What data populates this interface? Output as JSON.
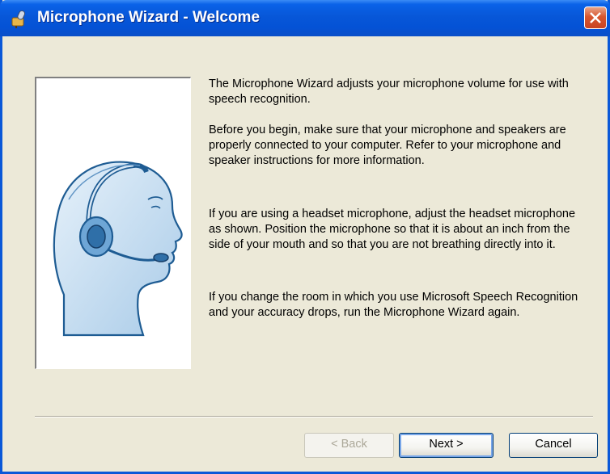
{
  "window": {
    "title": "Microphone Wizard - Welcome"
  },
  "content": {
    "paragraphs": [
      "The Microphone Wizard adjusts your microphone volume for use with speech recognition.",
      "Before you begin, make sure that your microphone and speakers are properly connected to your computer. Refer to your microphone and speaker instructions for more information.",
      "If you are using a headset microphone, adjust the headset microphone as shown. Position the microphone so that it is about an inch from the side of your mouth and so that you are not breathing directly into it.",
      "If you change the room in which you use Microsoft Speech Recognition and your accuracy drops, run the Microphone Wizard again."
    ]
  },
  "buttons": {
    "back_label": "< Back",
    "next_label": "Next >",
    "cancel_label": "Cancel"
  },
  "icons": {
    "title_icon": "microphone-icon",
    "close_icon": "close-icon",
    "illustration": "headset-illustration"
  },
  "colors": {
    "titlebar": "#0757d8",
    "dialog_background": "#ece9d8",
    "close_button": "#d8562f",
    "disabled_text": "#aca899"
  }
}
